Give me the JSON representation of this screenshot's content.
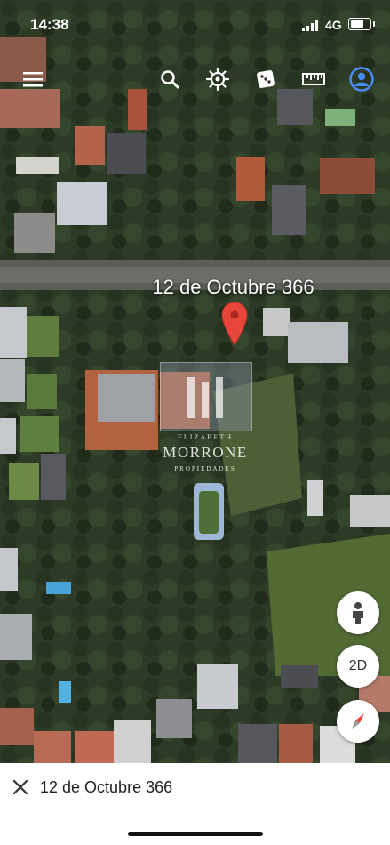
{
  "status_bar": {
    "time": "14:38",
    "network": "4G",
    "battery_level": 0.7
  },
  "toolbar": {
    "items": [
      {
        "name": "menu-icon",
        "icon": "hamburger"
      },
      {
        "name": "search-icon",
        "icon": "magnifier"
      },
      {
        "name": "voyager-icon",
        "icon": "ship-wheel"
      },
      {
        "name": "feeling-lucky-icon",
        "icon": "dice"
      },
      {
        "name": "measure-icon",
        "icon": "ruler"
      },
      {
        "name": "account-icon",
        "icon": "person-circle"
      }
    ],
    "account_color": "#4a8cf7"
  },
  "map": {
    "place_label": "12 de Octubre 366",
    "pin_color": "#e8463a"
  },
  "watermark": {
    "line1": "ELIZABETH",
    "line2": "MORRONE",
    "line3": "PROPIEDADES"
  },
  "controls": {
    "street_view": "street-view-icon",
    "view_mode": "2D",
    "compass": "compass-icon",
    "compass_color": "#e8463a"
  },
  "bottom_panel": {
    "title": "12 de Octubre 366"
  }
}
